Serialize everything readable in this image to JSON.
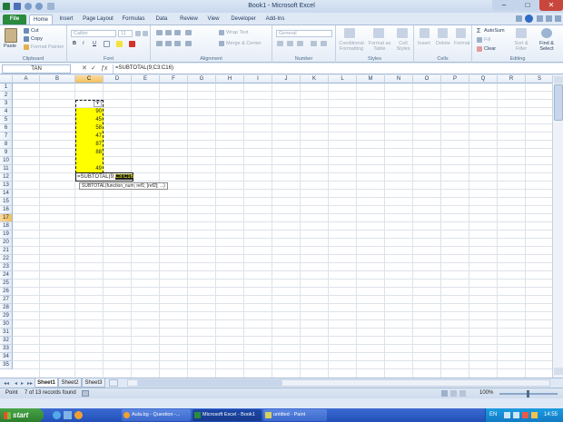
{
  "window": {
    "title": "Book1 - Microsoft Excel"
  },
  "tabs": [
    {
      "label": "File"
    },
    {
      "label": "Home"
    },
    {
      "label": "Insert"
    },
    {
      "label": "Page Layout"
    },
    {
      "label": "Formulas"
    },
    {
      "label": "Data"
    },
    {
      "label": "Review"
    },
    {
      "label": "View"
    },
    {
      "label": "Developer"
    },
    {
      "label": "Add-Ins"
    }
  ],
  "ribbon": {
    "clipboard": {
      "paste": "Paste",
      "cut": "Cut",
      "copy": "Copy",
      "format_painter": "Format Painter",
      "label": "Clipboard"
    },
    "font": {
      "name": "Calibri",
      "size": "11",
      "bold": "B",
      "italic": "I",
      "underline": "U",
      "label": "Font"
    },
    "alignment": {
      "wrap": "Wrap Text",
      "merge": "Merge & Center",
      "label": "Alignment"
    },
    "number": {
      "format": "General",
      "label": "Number"
    },
    "styles": {
      "conditional": "Conditional Formatting",
      "table": "Format as Table",
      "cell_styles": "Cell Styles",
      "label": "Styles"
    },
    "cells": {
      "insert": "Insert",
      "delete": "Delete",
      "format": "Format",
      "label": "Cells"
    },
    "editing": {
      "autosum": "AutoSum",
      "fill": "Fill",
      "clear": "Clear",
      "sort": "Sort & Filter",
      "find": "Find & Select",
      "label": "Editing"
    }
  },
  "formula_bar": {
    "name_box": "TAN",
    "formula": "=SUBTOTAL(9;C3:C16)"
  },
  "columns": [
    "A",
    "B",
    "C",
    "D",
    "E",
    "F",
    "G",
    "H",
    "I",
    "J",
    "K",
    "L",
    "M",
    "N",
    "O",
    "P",
    "Q",
    "R",
    "S"
  ],
  "rows": [
    "1",
    "2",
    "3",
    "4",
    "5",
    "6",
    "7",
    "8",
    "9",
    "10",
    "11",
    "12",
    "13",
    "14",
    "15",
    "16",
    "17",
    "18",
    "19",
    "20",
    "21",
    "22",
    "23",
    "24",
    "25",
    "26",
    "27",
    "28",
    "29",
    "30",
    "31",
    "32",
    "33",
    "34",
    "35"
  ],
  "cells": {
    "values": [
      "90",
      "45",
      "58",
      "47",
      "87",
      "88",
      "49"
    ],
    "edit_prefix": "=SUBTOTAL(9;",
    "edit_ref": "C3:C16",
    "tooltip": "SUBTOTAL(function_num; ref1; [ref2]; ...)"
  },
  "sheets": [
    {
      "label": "Sheet1"
    },
    {
      "label": "Sheet2"
    },
    {
      "label": "Sheet3"
    }
  ],
  "status": {
    "mode": "Point",
    "records": "7 of 13 records found",
    "zoom": "100%"
  },
  "taskbar": {
    "start": "start",
    "tasks": [
      {
        "label": "Aula.bg - Question -..."
      },
      {
        "label": "Microsoft Excel - Book1"
      },
      {
        "label": "untitled - Paint"
      }
    ],
    "lang": "EN",
    "time": "14:55"
  }
}
